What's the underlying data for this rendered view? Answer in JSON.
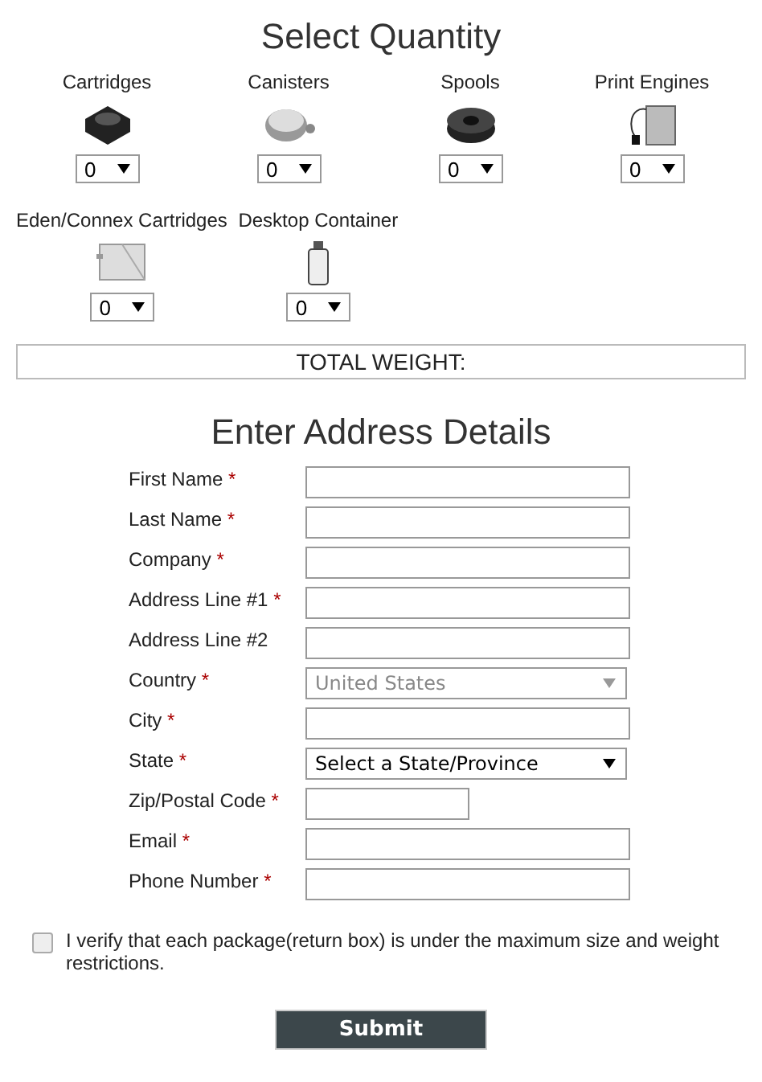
{
  "quantity_section": {
    "title": "Select Quantity",
    "products": [
      {
        "name": "Cartridges",
        "kind": "cartridge",
        "quantity": "0"
      },
      {
        "name": "Canisters",
        "kind": "canister",
        "quantity": "0"
      },
      {
        "name": "Spools",
        "kind": "spool",
        "quantity": "0"
      },
      {
        "name": "Print Engines",
        "kind": "engine",
        "quantity": "0"
      },
      {
        "name": "Eden/Connex Cartridges",
        "kind": "eden",
        "quantity": "0"
      },
      {
        "name": "Desktop Container",
        "kind": "bottle",
        "quantity": "0"
      }
    ],
    "total_weight": "TOTAL WEIGHT:"
  },
  "address_section": {
    "title": "Enter Address Details",
    "fields": [
      {
        "label": "First Name",
        "required_mark": "*",
        "kind": "text"
      },
      {
        "label": "Last Name",
        "required_mark": "*",
        "kind": "text"
      },
      {
        "label": "Company",
        "required_mark": "*",
        "kind": "text"
      },
      {
        "label": "Address Line #1",
        "required_mark": "*",
        "kind": "text"
      },
      {
        "label": "Address Line #2",
        "kind": "text"
      },
      {
        "label": "Country",
        "required_mark": "*",
        "kind": "select",
        "value": "United States",
        "disabled": true
      },
      {
        "label": "City",
        "required_mark": "*",
        "kind": "text"
      },
      {
        "label": "State",
        "required_mark": "*",
        "kind": "select",
        "value": "Select a State/Province",
        "disabled": false
      },
      {
        "label": "Zip/Postal Code",
        "required_mark": "*",
        "kind": "short-text"
      },
      {
        "label": "Email",
        "required_mark": "*",
        "kind": "text"
      },
      {
        "label": "Phone Number",
        "required_mark": "*",
        "kind": "text"
      }
    ]
  },
  "verify": {
    "label": "I verify that each package(return box) is under the maximum size and weight restrictions.",
    "checked": false
  },
  "submit": "Submit"
}
